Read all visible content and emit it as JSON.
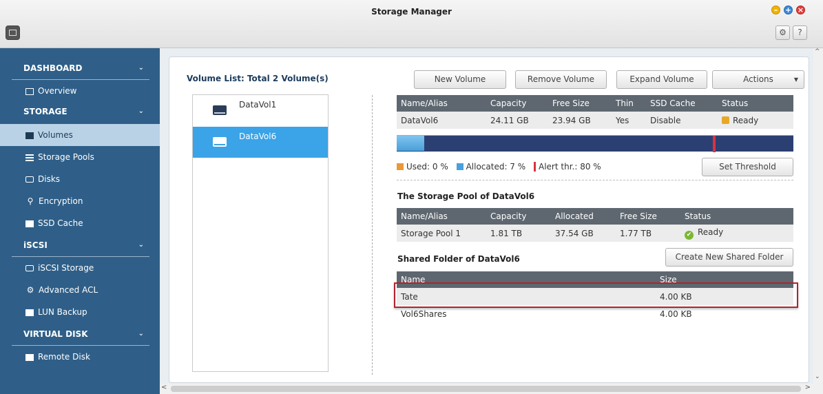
{
  "window": {
    "title": "Storage Manager"
  },
  "sidebar": {
    "sections": [
      {
        "label": "DASHBOARD"
      },
      {
        "label": "STORAGE"
      },
      {
        "label": "iSCSI"
      },
      {
        "label": "VIRTUAL DISK"
      }
    ],
    "items": [
      {
        "label": "Overview",
        "icon": "overview-icon"
      },
      {
        "label": "Volumes",
        "icon": "volumes-icon"
      },
      {
        "label": "Storage Pools",
        "icon": "storage-pools-icon"
      },
      {
        "label": "Disks",
        "icon": "disks-icon"
      },
      {
        "label": "Encryption",
        "icon": "encryption-icon"
      },
      {
        "label": "SSD Cache",
        "icon": "ssd-cache-icon"
      },
      {
        "label": "iSCSI Storage",
        "icon": "iscsi-storage-icon"
      },
      {
        "label": "Advanced ACL",
        "icon": "advanced-acl-icon"
      },
      {
        "label": "LUN Backup",
        "icon": "lun-backup-icon"
      },
      {
        "label": "Remote Disk",
        "icon": "remote-disk-icon"
      }
    ],
    "active_item": "Volumes"
  },
  "volume_list": {
    "title": "Volume List: Total 2 Volume(s)",
    "items": [
      {
        "label": "DataVol1"
      },
      {
        "label": "DataVol6"
      }
    ],
    "selected": "DataVol6"
  },
  "toolbar": {
    "new_volume": "New Volume",
    "remove_volume": "Remove Volume",
    "expand_volume": "Expand Volume",
    "actions": "Actions"
  },
  "volume_detail": {
    "headers": [
      "Name/Alias",
      "Capacity",
      "Free Size",
      "Thin",
      "SSD Cache",
      "Status"
    ],
    "row": [
      "DataVol6",
      "24.11 GB",
      "23.94 GB",
      "Yes",
      "Disable",
      "Ready"
    ],
    "usage": {
      "used_percent": 0,
      "allocated_percent": 7,
      "alert_percent": 80
    },
    "legend": {
      "used": "Used: 0 %",
      "allocated": "Allocated: 7 %",
      "alert": "Alert thr.: 80 %"
    },
    "set_threshold": "Set Threshold"
  },
  "storage_pool": {
    "title": "The Storage Pool of DataVol6",
    "headers": [
      "Name/Alias",
      "Capacity",
      "Allocated",
      "Free Size",
      "Status"
    ],
    "row": [
      "Storage Pool 1",
      "1.81 TB",
      "37.54 GB",
      "1.77 TB",
      "Ready"
    ]
  },
  "shared_folders": {
    "title": "Shared Folder of DataVol6",
    "create_button": "Create New Shared Folder",
    "headers": [
      "Name",
      "Size"
    ],
    "rows": [
      [
        "Tate",
        "4.00 KB"
      ],
      [
        "Vol6Shares",
        "4.00 KB"
      ]
    ]
  },
  "colors": {
    "sidebar_bg": "#2f5f88",
    "selection_blue": "#3ba3e7",
    "alert_red": "#d9333f",
    "highlight_border": "#b2222c"
  }
}
